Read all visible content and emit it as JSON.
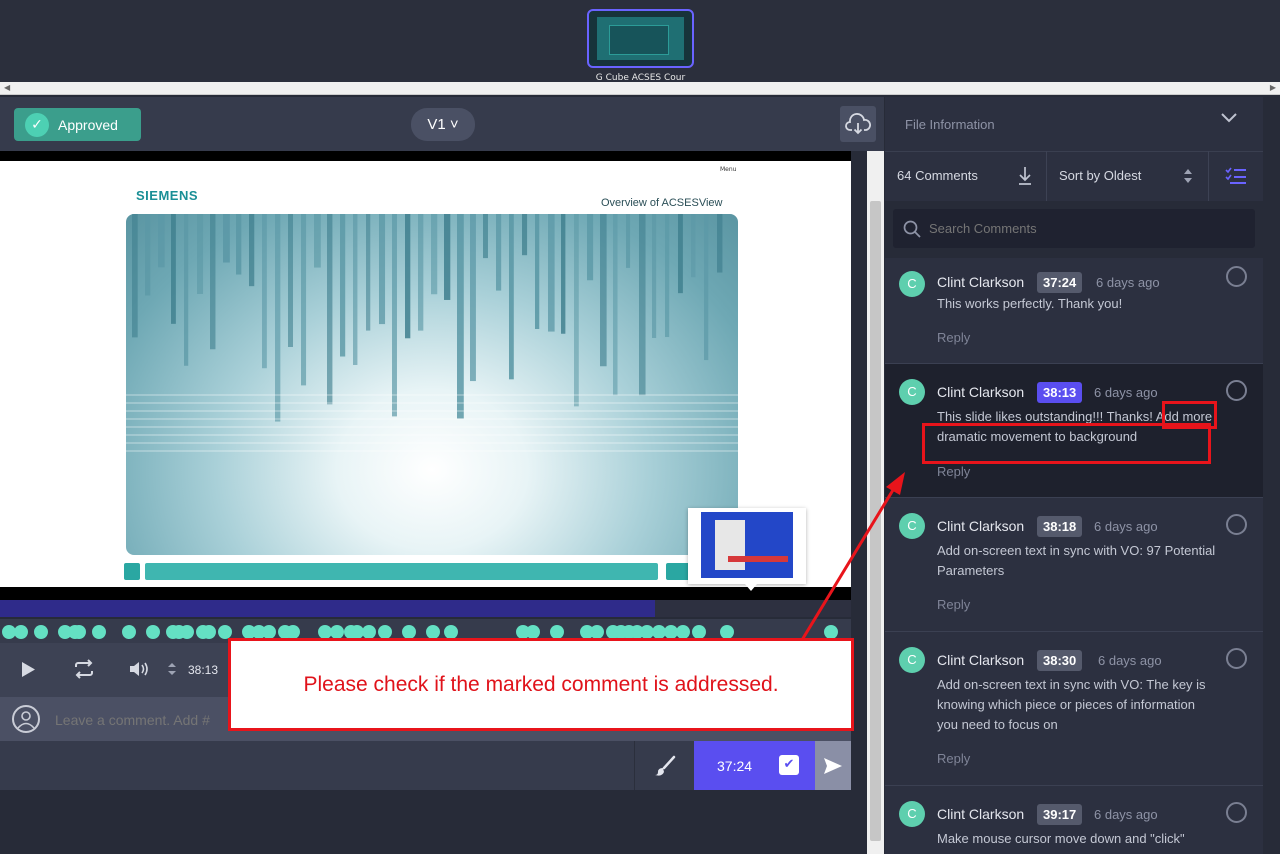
{
  "filmstrip": {
    "thumb_label": "G Cube ACSES Cour"
  },
  "header": {
    "status_label": "Approved",
    "version_label": "V1 ˅"
  },
  "slide": {
    "brand": "SIEMENS",
    "menu": "Menu",
    "title": "Overview of ACSESView"
  },
  "player": {
    "time": "38:13",
    "progress_fraction": 0.77
  },
  "composer": {
    "placeholder": "Leave a comment. Add #",
    "timestamp": "37:24"
  },
  "panel": {
    "file_info_label": "File Information",
    "comment_count": "64 Comments",
    "sort_label": "Sort by Oldest",
    "search_placeholder": "Search Comments"
  },
  "comments": [
    {
      "avatar": "C",
      "author": "Clint Clarkson",
      "timestamp": "37:24",
      "age": "6 days ago",
      "text": "This works perfectly. Thank you!",
      "reply": "Reply"
    },
    {
      "avatar": "C",
      "author": "Clint Clarkson",
      "timestamp": "38:13",
      "age": "6 days ago",
      "text": "This slide likes outstanding!!! Thanks! Add more dramatic movement to background",
      "reply": "Reply"
    },
    {
      "avatar": "C",
      "author": "Clint Clarkson",
      "timestamp": "38:18",
      "age": "6 days ago",
      "text": "Add on-screen text in sync with VO: 97 Potential Parameters",
      "reply": "Reply"
    },
    {
      "avatar": "C",
      "author": "Clint Clarkson",
      "timestamp": "38:30",
      "age": "6 days ago",
      "text": "Add on-screen text in sync with VO: The key  is knowing which piece or pieces of information you need to focus on",
      "reply": "Reply"
    },
    {
      "avatar": "C",
      "author": "Clint Clarkson",
      "timestamp": "39:17",
      "age": "6 days ago",
      "text": "Make mouse cursor move down and \"click\"",
      "reply": ""
    }
  ],
  "annotation": {
    "callout_text": "Please check if the marked comment is addressed."
  },
  "colors": {
    "accent": "#5a4ef0",
    "approved": "#3b9e8c",
    "marker": "#64e0c3",
    "annotation": "#e8141b"
  }
}
